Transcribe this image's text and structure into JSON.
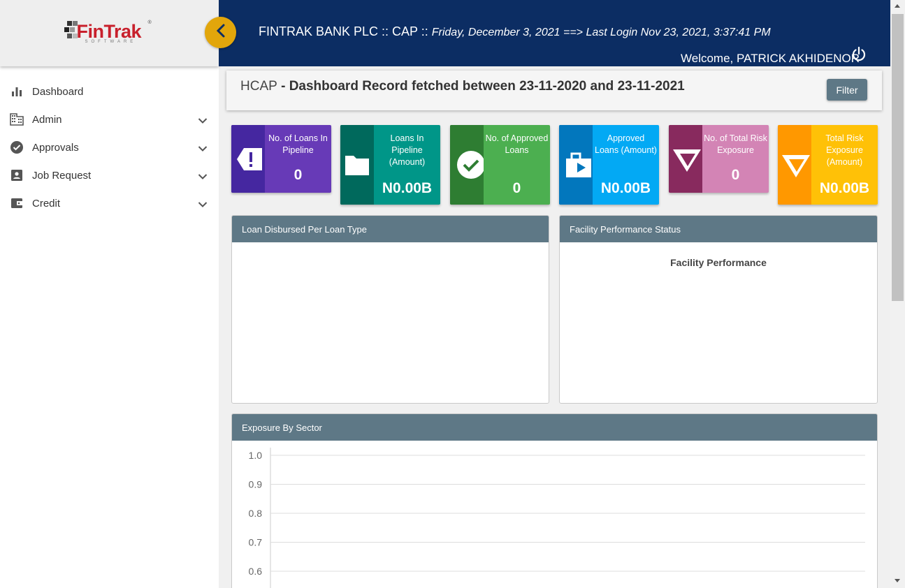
{
  "app": {
    "logo_text": "FinTrak",
    "logo_sub": "SOFTWARE",
    "logo_reg": "®"
  },
  "header": {
    "title": "FINTRAK BANK PLC :: CAP ::",
    "date_info": "Friday, December 3, 2021 ==> Last Login Nov 23, 2021, 3:37:41 PM",
    "welcome": "Welcome, PATRICK AKHIDENOR",
    "power_icon": "power-icon",
    "toggle_icon": "chevron-left-icon",
    "colors": {
      "bar": "#0c2d63",
      "toggle": "#e2a60b"
    }
  },
  "sidebar": {
    "items": [
      {
        "label": "Dashboard",
        "icon": "bar-chart-icon",
        "expandable": false
      },
      {
        "label": "Admin",
        "icon": "building-icon",
        "expandable": true
      },
      {
        "label": "Approvals",
        "icon": "check-circle-icon",
        "expandable": true
      },
      {
        "label": "Job Request",
        "icon": "id-card-icon",
        "expandable": true
      },
      {
        "label": "Credit",
        "icon": "wallet-icon",
        "expandable": true
      }
    ]
  },
  "content": {
    "title_prefix": "HCAP",
    "title_sep": " - ",
    "title_main": "Dashboard Record fetched between 23-11-2020 and 23-11-2021",
    "filter_label": "Filter"
  },
  "cards": [
    {
      "label": "No. of Loans In Pipeline",
      "value": "0",
      "icon": "alert-tag-icon",
      "dark": "#4527a0",
      "light": "#673ab7"
    },
    {
      "label": "Loans In Pipeline (Amount)",
      "value": "N0.00B",
      "icon": "folder-icon",
      "dark": "#00695c",
      "light": "#009688"
    },
    {
      "label": "No. of Approved Loans",
      "value": "0",
      "icon": "check-circle-icon",
      "dark": "#2e7d32",
      "light": "#4caf50"
    },
    {
      "label": "Approved Loans (Amount)",
      "value": "N0.00B",
      "icon": "briefcase-play-icon",
      "dark": "#0277bd",
      "light": "#03a9f4"
    },
    {
      "label": "No. of Total Risk Exposure",
      "value": "0",
      "icon": "triangle-down-icon",
      "dark": "#882a5e",
      "light": "#d384b5"
    },
    {
      "label": "Total Risk Exposure (Amount)",
      "value": "N0.00B",
      "icon": "triangle-down-icon",
      "dark": "#ff9800",
      "light": "#ffc107"
    }
  ],
  "panels": {
    "loan_disbursed": {
      "title": "Loan Disbursed Per Loan Type"
    },
    "facility": {
      "title": "Facility Performance Status",
      "chart_title": "Facility Performance"
    },
    "exposure": {
      "title": "Exposure By Sector"
    }
  },
  "chart_data": {
    "type": "bar",
    "title": "",
    "xlabel": "",
    "ylabel": "",
    "categories": [],
    "series": [],
    "ylim": [
      0,
      1.0
    ],
    "yticks": [
      "1.0",
      "0.9",
      "0.8",
      "0.7",
      "0.6"
    ],
    "grid": true
  }
}
